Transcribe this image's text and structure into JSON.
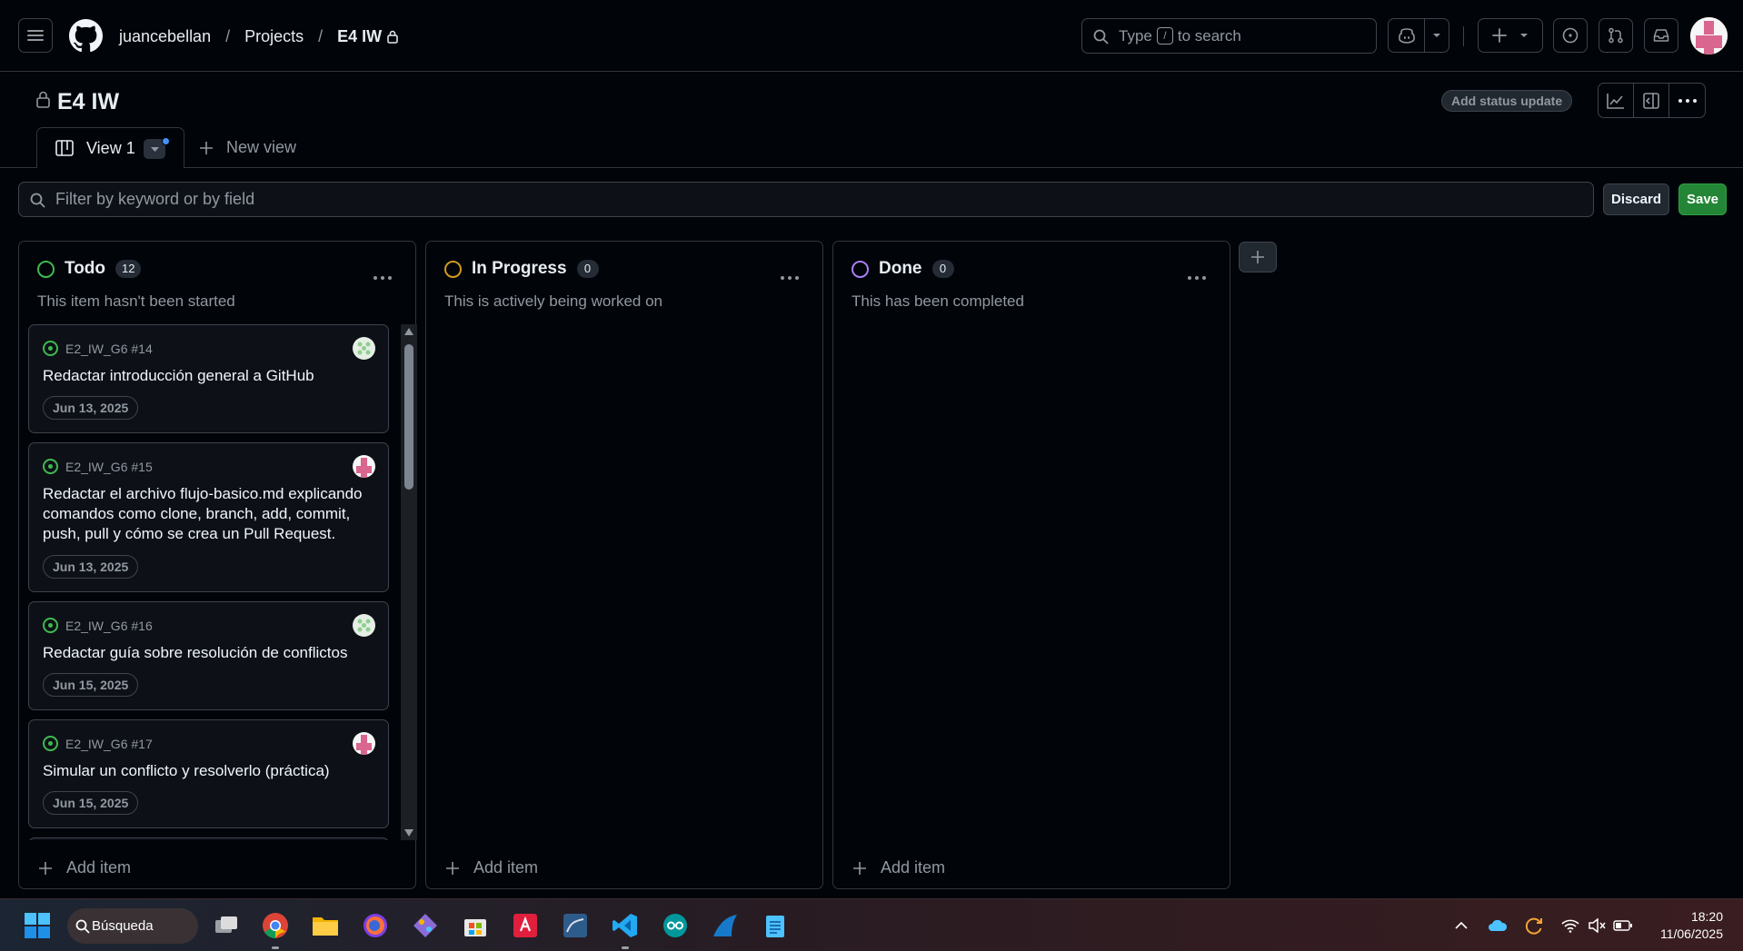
{
  "header": {
    "breadcrumb": {
      "owner": "juancebellan",
      "section": "Projects",
      "project": "E4 IW"
    },
    "search": {
      "prefix": "Type",
      "key": "/",
      "suffix": "to search"
    }
  },
  "project": {
    "title": "E4 IW",
    "status_update_label": "Add status update",
    "tabs": [
      {
        "label": "View 1"
      }
    ],
    "new_view_label": "New view"
  },
  "filter": {
    "placeholder": "Filter by keyword or by field",
    "discard_label": "Discard",
    "save_label": "Save"
  },
  "columns": [
    {
      "name": "Todo",
      "count": "12",
      "color": "#3fb950",
      "description": "This item hasn't been started",
      "cards": [
        {
          "ref": "E2_IW_G6 #14",
          "title": "Redactar introducción general a GitHub",
          "date": "Jun 13, 2025",
          "avatar": "green"
        },
        {
          "ref": "E2_IW_G6 #15",
          "title": "Redactar el archivo flujo-basico.md explicando comandos como clone, branch, add, commit, push, pull y cómo se crea un Pull Request.",
          "date": "Jun 13, 2025",
          "avatar": "pink"
        },
        {
          "ref": "E2_IW_G6 #16",
          "title": "Redactar guía sobre resolución de conflictos",
          "date": "Jun 15, 2025",
          "avatar": "green"
        },
        {
          "ref": "E2_IW_G6 #17",
          "title": "Simular un conflicto y resolverlo (práctica)",
          "date": "Jun 15, 2025",
          "avatar": "pink"
        }
      ],
      "add_item_label": "Add item"
    },
    {
      "name": "In Progress",
      "count": "0",
      "color": "#d29922",
      "description": "This is actively being worked on",
      "cards": [],
      "add_item_label": "Add item"
    },
    {
      "name": "Done",
      "count": "0",
      "color": "#ab7df8",
      "description": "This has been completed",
      "cards": [],
      "add_item_label": "Add item"
    }
  ],
  "taskbar": {
    "search_label": "Búsqueda",
    "time": "18:20",
    "date": "11/06/2025"
  }
}
